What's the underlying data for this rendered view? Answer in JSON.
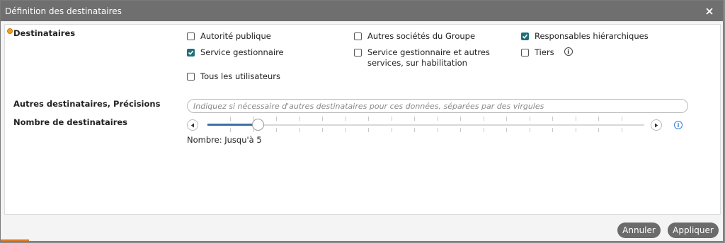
{
  "dialog": {
    "title": "Définition des destinataires",
    "close_icon": "close-icon"
  },
  "recipients": {
    "label": "Destinataires",
    "options": [
      {
        "label": "Autorité publique",
        "checked": false
      },
      {
        "label": "Autres sociétés du Groupe",
        "checked": false
      },
      {
        "label": "Responsables hiérarchiques",
        "checked": true
      },
      {
        "label": "Service gestionnaire",
        "checked": true
      },
      {
        "label": "Service gestionnaire et autres services, sur habilitation",
        "checked": false
      },
      {
        "label": "Tiers",
        "checked": false
      },
      {
        "label": "Tous les utilisateurs",
        "checked": false
      }
    ]
  },
  "other_recipients": {
    "label": "Autres destinataires, Précisions",
    "value": "",
    "placeholder": "Indiquez si nécessaire d'autres destinataires pour ces données, séparées par des virgules"
  },
  "recipient_count": {
    "label": "Nombre de destinataires",
    "value_text": "Nombre: Jusqu'à 5",
    "slider_value_fraction": 0.115
  },
  "footer": {
    "cancel_label": "Annuler",
    "apply_label": "Appliquer"
  },
  "colors": {
    "accent": "#1f6f7a",
    "slider_fill": "#3a6fa5",
    "info_blue": "#3a7bd5",
    "button": "#6b6b6b"
  }
}
